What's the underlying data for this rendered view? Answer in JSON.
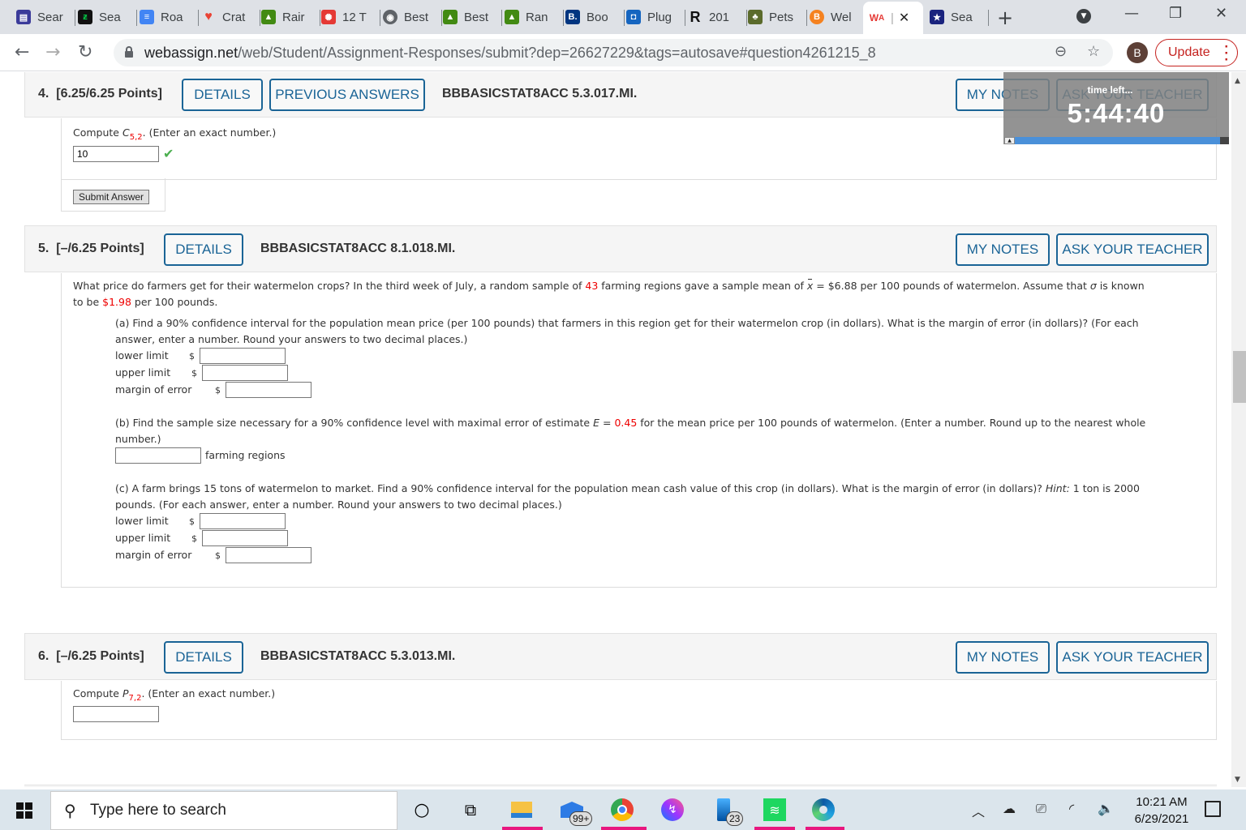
{
  "browser": {
    "tabs": [
      {
        "label": "Sear",
        "icon": "building-icon",
        "color": "#3b3b9a"
      },
      {
        "label": "Sea",
        "icon": "deviantart-icon",
        "color": "#05cc47"
      },
      {
        "label": "Roa",
        "icon": "google-docs-icon",
        "color": "#4285f4"
      },
      {
        "label": "Crat",
        "icon": "google-maps-icon",
        "color": "#34a853"
      },
      {
        "label": "Rair",
        "icon": "alltrails-icon",
        "color": "#428a13"
      },
      {
        "label": "12 T",
        "icon": "weather-icon",
        "color": "#e53935"
      },
      {
        "label": "Best",
        "icon": "globe-icon",
        "color": "#5f6368"
      },
      {
        "label": "Best",
        "icon": "alltrails-icon",
        "color": "#428a13"
      },
      {
        "label": "Ran",
        "icon": "alltrails-icon",
        "color": "#428a13"
      },
      {
        "label": "Boo",
        "icon": "booking-icon",
        "color": "#003580"
      },
      {
        "label": "Plug",
        "icon": "plugin-icon",
        "color": "#1565c0"
      },
      {
        "label": "201",
        "icon": "r-icon",
        "color": "#111111"
      },
      {
        "label": "Pets",
        "icon": "nps-icon",
        "color": "#5b6b2c"
      },
      {
        "label": "Wel",
        "icon": "b-logo-icon",
        "color": "#f58220"
      },
      {
        "label": "WA",
        "icon": "webassign-icon",
        "color": "#e53935",
        "active": true
      },
      {
        "label": "Sea",
        "icon": "star-shield-icon",
        "color": "#1a237e"
      }
    ],
    "new_tab": "+",
    "url_host": "webassign.net",
    "url_path": "/web/Student/Assignment-Responses/submit?dep=26627229&tags=autosave#question4261215_8",
    "profile_initial": "B",
    "update_label": "Update"
  },
  "timer": {
    "label": "time left...",
    "value": "5:44:40"
  },
  "questions": [
    {
      "number": "4.",
      "points": "[6.25/6.25 Points]",
      "details_label": "DETAILS",
      "prev_answers_label": "PREVIOUS ANSWERS",
      "code": "BBBASICSTAT8ACC 5.3.017.MI.",
      "my_notes_label": "MY NOTES",
      "ask_teacher_label": "ASK YOUR TEACHER",
      "prompt_pre": "Compute ",
      "prompt_var": "C",
      "prompt_sub": "5,2",
      "prompt_post": ". (Enter an exact number.)",
      "answer": "10",
      "status": "correct",
      "submit_label": "Submit Answer"
    },
    {
      "number": "5.",
      "points": "[–/6.25 Points]",
      "details_label": "DETAILS",
      "code": "BBBASICSTAT8ACC 8.1.018.MI.",
      "my_notes_label": "MY NOTES",
      "ask_teacher_label": "ASK YOUR TEACHER",
      "intro": {
        "t1": "What price do farmers get for their watermelon crops? In the third week of July, a random sample of ",
        "n": "43",
        "t2": " farming regions gave a sample mean of ",
        "xbar": "x",
        "t3": " = $6.88 per 100 pounds of watermelon. Assume that ",
        "sigma": "σ",
        "t4": " is known",
        "t5": "to be ",
        "sigma_val": "$1.98",
        "t6": " per 100 pounds."
      },
      "part_a": {
        "line1": "(a) Find a 90% confidence interval for the population mean price (per 100 pounds) that farmers in this region get for their watermelon crop (in dollars). What is the margin of error (in dollars)? (For each",
        "line2": "answer, enter a number. Round your answers to two decimal places.)",
        "fields": [
          {
            "label": "lower limit",
            "prefix": "$",
            "value": ""
          },
          {
            "label": "upper limit",
            "prefix": "$",
            "value": ""
          },
          {
            "label": "margin of error",
            "prefix": "$",
            "value": ""
          }
        ]
      },
      "part_b": {
        "t1": "(b) Find the sample size necessary for a 90% confidence level with maximal error of estimate ",
        "e_var": "E",
        "t2": " = ",
        "e_val": "0.45",
        "t3": " for the mean price per 100 pounds of watermelon. (Enter a number. Round up to the nearest whole",
        "line2": "number.)",
        "unit": "farming regions",
        "value": ""
      },
      "part_c": {
        "t1": "(c) A farm brings 15 tons of watermelon to market. Find a 90% confidence interval for the population mean cash value of this crop (in dollars). What is the margin of error (in dollars)? ",
        "hint": "Hint:",
        "t2": " 1 ton is 2000",
        "line2": "pounds. (For each answer, enter a number. Round your answers to two decimal places.)",
        "fields": [
          {
            "label": "lower limit",
            "prefix": "$",
            "value": ""
          },
          {
            "label": "upper limit",
            "prefix": "$",
            "value": ""
          },
          {
            "label": "margin of error",
            "prefix": "$",
            "value": ""
          }
        ]
      }
    },
    {
      "number": "6.",
      "points": "[–/6.25 Points]",
      "details_label": "DETAILS",
      "code": "BBBASICSTAT8ACC 5.3.013.MI.",
      "my_notes_label": "MY NOTES",
      "ask_teacher_label": "ASK YOUR TEACHER",
      "prompt_pre": "Compute ",
      "prompt_var": "P",
      "prompt_sub": "7,2",
      "prompt_post": ". (Enter an exact number.)",
      "answer": ""
    }
  ],
  "taskbar": {
    "search_placeholder": "Type here to search",
    "mail_badge": "99+",
    "phone_badge": "23",
    "time": "10:21 AM",
    "date": "6/29/2021"
  }
}
